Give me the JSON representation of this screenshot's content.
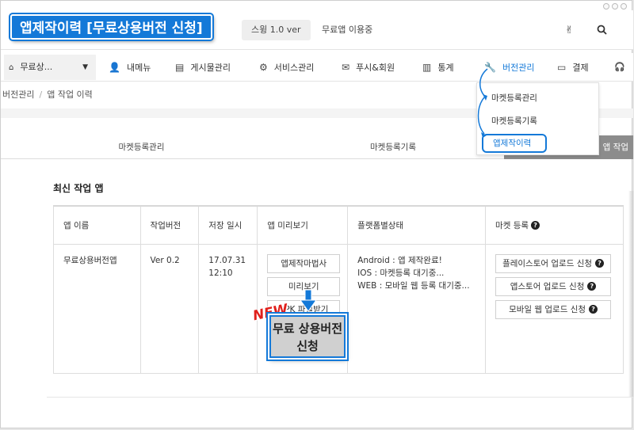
{
  "header": {
    "app_title": "앱제작이력 [무료상용버전 신청]",
    "version": "스윙 1.0 ver",
    "plan_status": "무료앱 이용중",
    "search_icon": "search-icon",
    "user_icon": "hand-icon"
  },
  "nav": {
    "app_select": "무료상...",
    "items": [
      {
        "label": "내메뉴",
        "icon": "user-icon"
      },
      {
        "label": "게시물관리",
        "icon": "document-icon"
      },
      {
        "label": "서비스관리",
        "icon": "gear-icon"
      },
      {
        "label": "푸시&회원",
        "icon": "envelope-icon"
      },
      {
        "label": "통계",
        "icon": "bar-chart-icon"
      },
      {
        "label": "버전관리",
        "icon": "wrench-icon"
      },
      {
        "label": "결제",
        "icon": "card-icon"
      }
    ],
    "active_color": "#1479d8"
  },
  "breadcrumb": {
    "parent": "버전관리",
    "current": "앱 작업 이력"
  },
  "dropdown": {
    "items": [
      "마켓등록관리",
      "마켓등록기록",
      "앱제작이력"
    ]
  },
  "tabs": [
    {
      "label": "마켓등록관리"
    },
    {
      "label": "마켓등록기록"
    },
    {
      "label": "앱 작업"
    }
  ],
  "section_title": "최신 작업 앱",
  "table": {
    "headers": [
      "앱 이름",
      "작업버전",
      "저장 일시",
      "앱 미리보기",
      "플랫폼별상태",
      "마켓 등록"
    ],
    "row": {
      "app_name": "무료상용버전앱",
      "version": "Ver 0.2",
      "saved_date": "17.07.31",
      "saved_time": "12:10",
      "preview_buttons": [
        "앱제작마법사",
        "미리보기",
        "APK 파일받기"
      ],
      "platform_status": [
        "Android : 앱 제작완료!",
        "IOS : 마켓등록 대기중...",
        "WEB : 모바일 웹 등록 대기중..."
      ],
      "market_buttons": [
        "플레이스토어 업로드 신청",
        "앱스토어 업로드 신청",
        "모바일 웹 업로드 신청"
      ]
    }
  },
  "callout": {
    "badge": "NEW",
    "button_line1": "무료 상용버전",
    "button_line2": "신청"
  },
  "accent_color": "#1479d8",
  "badge_color": "#e0201c"
}
